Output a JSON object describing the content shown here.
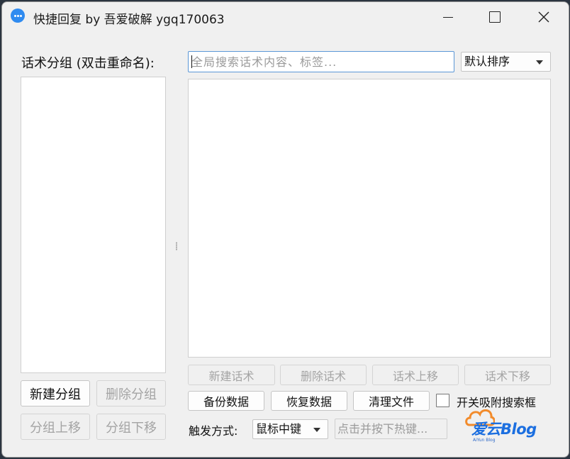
{
  "window": {
    "title": "快捷回复 by 吾爱破解 ygq170063"
  },
  "left_panel": {
    "heading": "话术分组 (双击重命名):",
    "buttons": {
      "new_group": "新建分组",
      "delete_group": "删除分组",
      "move_up": "分组上移",
      "move_down": "分组下移"
    }
  },
  "right_panel": {
    "search": {
      "value": "",
      "placeholder": "全局搜索话术内容、标签..."
    },
    "sort": {
      "selected": "默认排序"
    },
    "script_buttons": {
      "new_script": "新建话术",
      "delete_script": "删除话术",
      "move_up": "话术上移",
      "move_down": "话术下移"
    },
    "data_buttons": {
      "backup": "备份数据",
      "restore": "恢复数据",
      "clean_files": "清理文件"
    },
    "attach_checkbox": {
      "label": "开关吸附搜索框",
      "checked": false
    },
    "trigger": {
      "label": "触发方式:",
      "selected": "鼠标中键",
      "hotkey_placeholder": "点击并按下热键..."
    }
  },
  "watermark": {
    "text": "爱云Blog",
    "subtext": "AiYun Blog"
  },
  "colors": {
    "accent": "#2f8bf0",
    "focus_border": "#5b97d6",
    "disabled_text": "#a4a4a4"
  }
}
